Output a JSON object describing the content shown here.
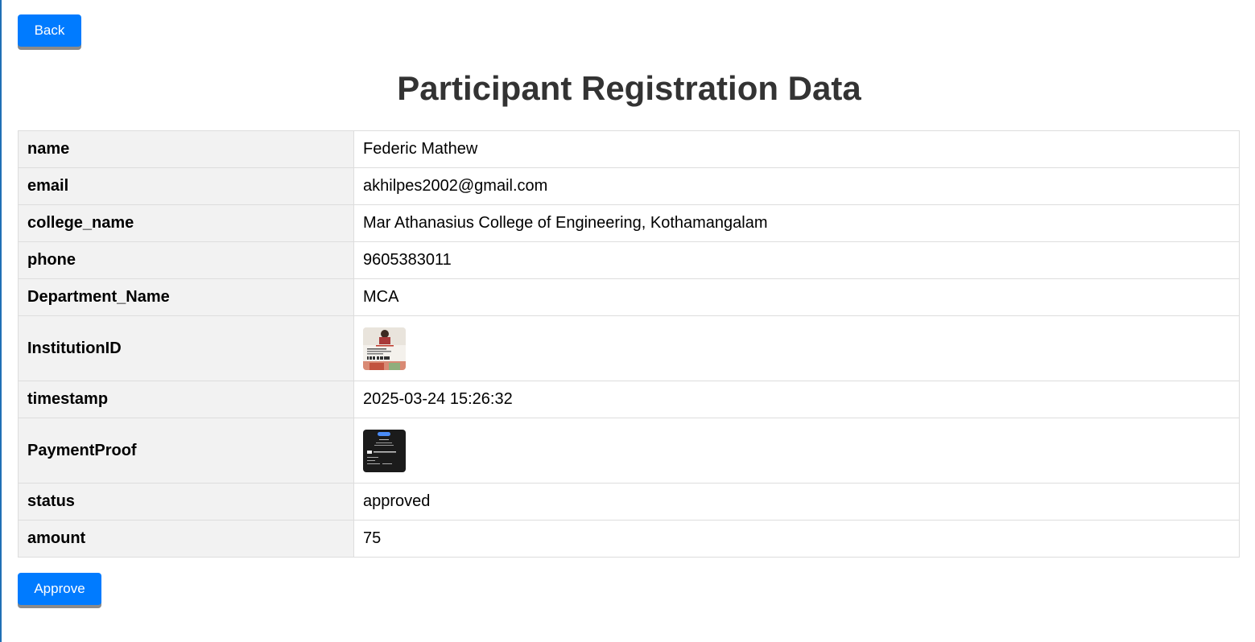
{
  "back_label": "Back",
  "page_title": "Participant Registration Data",
  "rows": [
    {
      "key": "name",
      "value": "Federic Mathew"
    },
    {
      "key": "email",
      "value": "akhilpes2002@gmail.com"
    },
    {
      "key": "college_name",
      "value": "Mar Athanasius College of Engineering, Kothamangalam"
    },
    {
      "key": "phone",
      "value": "9605383011"
    },
    {
      "key": "Department_Name",
      "value": "MCA"
    },
    {
      "key": "InstitutionID",
      "value": ""
    },
    {
      "key": "timestamp",
      "value": "2025-03-24 15:26:32"
    },
    {
      "key": "PaymentProof",
      "value": ""
    },
    {
      "key": "status",
      "value": "approved"
    },
    {
      "key": "amount",
      "value": "75"
    }
  ],
  "approve_label": "Approve",
  "colors": {
    "button": "#007bff",
    "header_cell": "#f2f2f2",
    "title": "#333333"
  }
}
